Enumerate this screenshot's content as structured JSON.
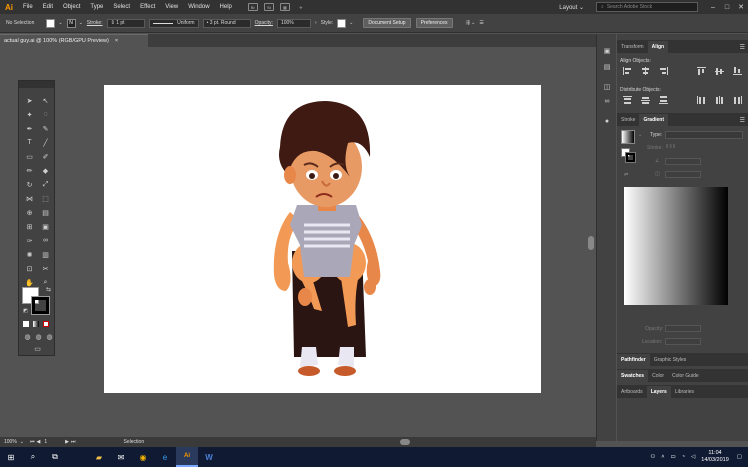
{
  "app": {
    "logo": "Ai",
    "menu": [
      "File",
      "Edit",
      "Object",
      "Type",
      "Select",
      "Effect",
      "View",
      "Window",
      "Help"
    ],
    "bridge_icons": [
      "Br",
      "St"
    ],
    "layout_label": "Layout",
    "search_placeholder": "Search Adobe Stock"
  },
  "control_bar": {
    "selection_label": "No Selection",
    "stroke_label": "Stroke:",
    "stroke_value": "1 pt",
    "uniform_label": "Uniform",
    "brush_label": "3 pt. Round",
    "opacity_label": "Opacity:",
    "opacity_value": "100%",
    "style_label": "Style:",
    "document_setup": "Document Setup",
    "preferences": "Preferences"
  },
  "document": {
    "tab_title": "actual guy.ai @ 100% (RGB/GPU Preview)",
    "tab_close": "×"
  },
  "panels": {
    "top_tabs": [
      "Transform",
      "Align"
    ],
    "align_objects_label": "Align Objects:",
    "distribute_objects_label": "Distribute Objects:",
    "mid_tabs": [
      "Stroke",
      "Gradient"
    ],
    "gradient_type_label": "Type:",
    "gradient_stroke_label": "Stroke:",
    "opacity_label": "Opacity:",
    "location_label": "Location:",
    "bottom_tabs_1": [
      "Pathfinder",
      "Graphic Styles"
    ],
    "bottom_tabs_2": [
      "Swatches",
      "Color",
      "Color Guide"
    ],
    "bottom_tabs_3": [
      "Artboards",
      "Layers",
      "Libraries"
    ]
  },
  "status_bar": {
    "zoom": "100%",
    "artboard_num": "1",
    "mode": "Selection"
  },
  "taskbar": {
    "time": "11:04",
    "date": "14/03/2019"
  },
  "colors": {
    "accent": "#ff9a00",
    "chrome": "#535353",
    "taskbar": "#101b33"
  }
}
